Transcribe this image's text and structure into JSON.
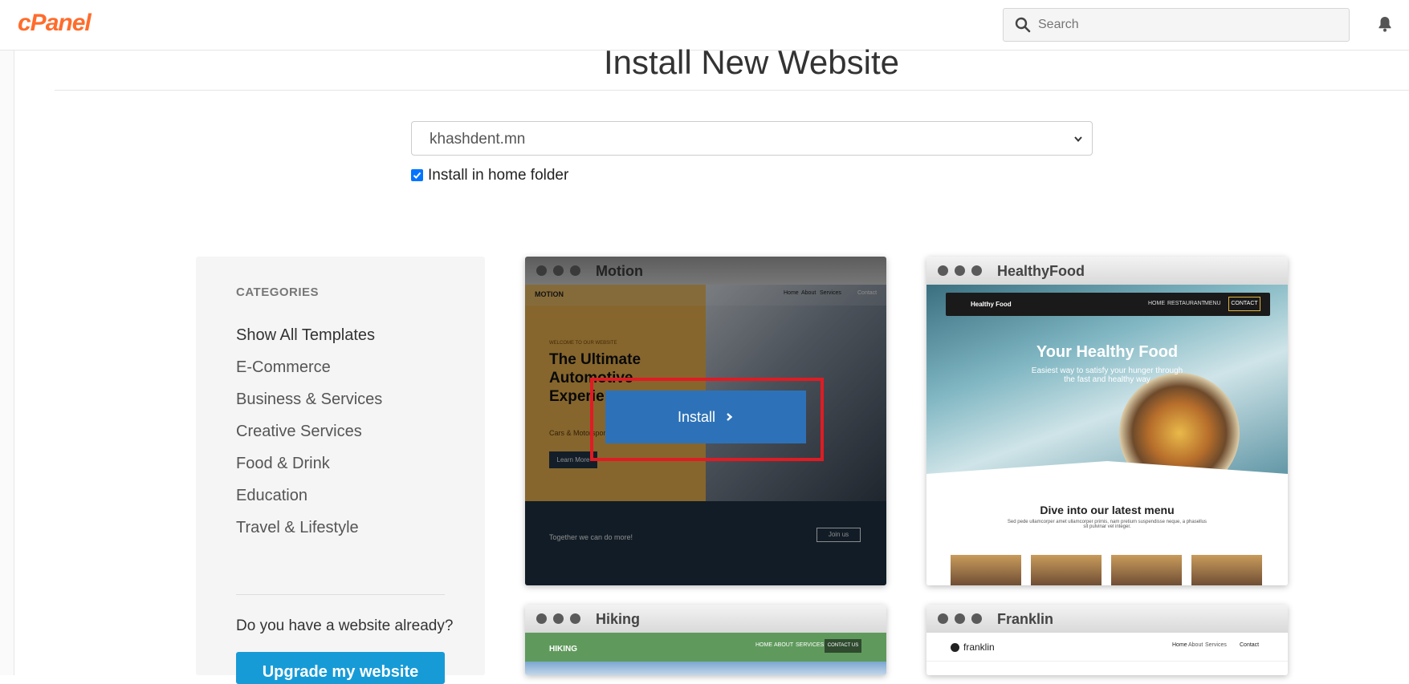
{
  "header": {
    "logo": "cPanel",
    "search_placeholder": "Search"
  },
  "page": {
    "title": "Install New Website",
    "domain_selected": "khashdent.mn",
    "install_home_label": "Install in home folder",
    "install_home_checked": true
  },
  "sidebar": {
    "heading": "CATEGORIES",
    "categories": [
      "Show All Templates",
      "E-Commerce",
      "Business & Services",
      "Creative Services",
      "Food & Drink",
      "Education",
      "Travel & Lifestyle"
    ],
    "question": "Do you have a website already?",
    "upgrade_label": "Upgrade my website"
  },
  "templates": [
    {
      "name": "Motion",
      "install_label": "Install",
      "nav_brand": "MOTION",
      "nav_links": [
        "Home",
        "About",
        "Services",
        "Contact"
      ],
      "kicker": "WELCOME TO OUR WEBSITE",
      "headline": "The Ultimate Automotive Experience",
      "sub": "Cars & Motorsport",
      "cta": "Learn More",
      "footer_text": "Together we can do more!",
      "footer_cta": "Join us"
    },
    {
      "name": "HealthyFood",
      "nav_brand": "Healthy Food",
      "nav_links": [
        "HOME",
        "RESTAURANT",
        "MENU"
      ],
      "nav_cta": "CONTACT",
      "headline": "Your Healthy Food",
      "sub": "Easiest way to satisfy your hunger through the fast and healthy way",
      "section_title": "Dive into our latest menu",
      "section_text": "Sed pede ullamcorper amet ullamcorper primis, nam pretium suspendisse neque, a phasellus sit pulvinar vel integer."
    },
    {
      "name": "Hiking",
      "nav_brand": "HIKING",
      "nav_links": [
        "HOME",
        "ABOUT",
        "SERVICES"
      ],
      "nav_cta": "CONTACT US"
    },
    {
      "name": "Franklin",
      "nav_brand": "franklin",
      "nav_links": [
        "Home",
        "About",
        "Services"
      ],
      "nav_cta": "Contact"
    }
  ]
}
